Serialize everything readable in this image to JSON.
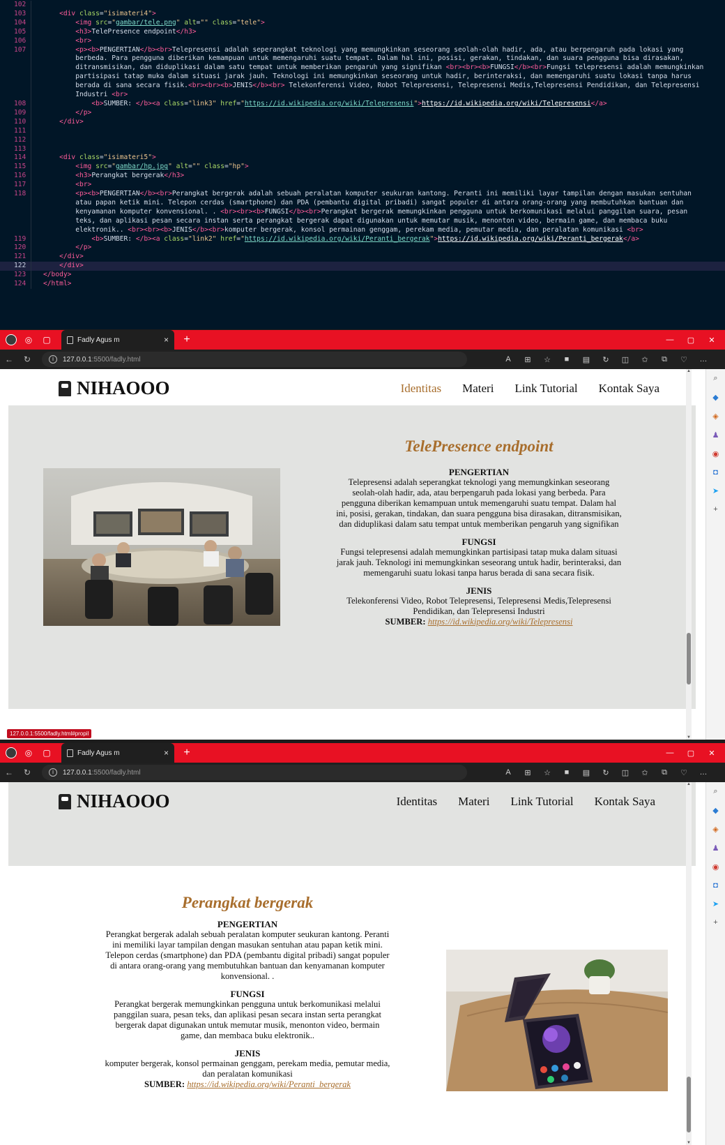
{
  "editor": {
    "lines": [
      {
        "n": "102",
        "html": ""
      },
      {
        "n": "103",
        "html": "    <span class=\"t\">&lt;div</span> <span class=\"a\">class</span>=<span class=\"s\">\"isimateri4\"</span><span class=\"t\">&gt;</span>"
      },
      {
        "n": "104",
        "html": "        <span class=\"t\">&lt;img</span> <span class=\"a\">src</span>=<span class=\"s\">\"</span><span class=\"u\">gambar/tele.png</span><span class=\"s\">\"</span> <span class=\"a\">alt</span>=<span class=\"s\">\"\"</span> <span class=\"a\">class</span>=<span class=\"s\">\"tele\"</span><span class=\"t\">&gt;</span>"
      },
      {
        "n": "105",
        "html": "        <span class=\"t\">&lt;h3&gt;</span>TelePresence endpoint<span class=\"t\">&lt;/h3&gt;</span>"
      },
      {
        "n": "106",
        "html": "        <span class=\"t\">&lt;br&gt;</span>"
      },
      {
        "n": "107",
        "html": "        <span class=\"t\">&lt;p&gt;&lt;b&gt;</span>PENGERTIAN<span class=\"t\">&lt;/b&gt;&lt;br&gt;</span>Telepresensi adalah seperangkat teknologi yang memungkinkan seseorang seolah-olah hadir, ada, atau berpengaruh pada lokasi yang"
      },
      {
        "n": "",
        "html": "        berbeda. Para pengguna diberikan kemampuan untuk memengaruhi suatu tempat. Dalam hal ini, posisi, gerakan, tindakan, dan suara pengguna bisa dirasakan,"
      },
      {
        "n": "",
        "html": "        ditransmisikan, dan diduplikasi dalam satu tempat untuk memberikan pengaruh yang signifikan <span class=\"t\">&lt;br&gt;&lt;br&gt;&lt;b&gt;</span>FUNGSI<span class=\"t\">&lt;/b&gt;&lt;br&gt;</span>Fungsi telepresensi adalah memungkinkan"
      },
      {
        "n": "",
        "html": "        partisipasi tatap muka dalam situasi jarak jauh. Teknologi ini memungkinkan seseorang untuk hadir, berinteraksi, dan memengaruhi suatu lokasi tanpa harus"
      },
      {
        "n": "",
        "html": "        berada di sana secara fisik.<span class=\"t\">&lt;br&gt;&lt;br&gt;&lt;b&gt;</span>JENIS<span class=\"t\">&lt;/b&gt;&lt;br&gt;</span> Telekonferensi Video, Robot Telepresensi, Telepresensi Medis,Telepresensi Pendidikan, dan Telepresensi"
      },
      {
        "n": "",
        "html": "        Industri <span class=\"t\">&lt;br&gt;</span>"
      },
      {
        "n": "108",
        "html": "            <span class=\"t\">&lt;b&gt;</span>SUMBER: <span class=\"t\">&lt;/b&gt;&lt;a</span> <span class=\"a\">class</span>=<span class=\"s\">\"link3\"</span> <span class=\"a\">href</span>=<span class=\"s\">\"</span><span class=\"u\">https://id.wikipedia.org/wiki/Telepresensi</span><span class=\"s\">\"</span><span class=\"t\">&gt;</span><span class=\"l\">https://id.wikipedia.org/wiki/Telepresensi</span><span class=\"t\">&lt;/a&gt;</span>"
      },
      {
        "n": "109",
        "html": "        <span class=\"t\">&lt;/p&gt;</span>"
      },
      {
        "n": "110",
        "html": "    <span class=\"t\">&lt;/div&gt;</span>"
      },
      {
        "n": "111",
        "html": ""
      },
      {
        "n": "112",
        "html": ""
      },
      {
        "n": "113",
        "html": ""
      },
      {
        "n": "114",
        "html": "    <span class=\"t\">&lt;div</span> <span class=\"a\">class</span>=<span class=\"s\">\"isimateri5\"</span><span class=\"t\">&gt;</span>"
      },
      {
        "n": "115",
        "html": "        <span class=\"t\">&lt;img</span> <span class=\"a\">src</span>=<span class=\"s\">\"</span><span class=\"u\">gambar/hp.jpg</span><span class=\"s\">\"</span> <span class=\"a\">alt</span>=<span class=\"s\">\"\"</span> <span class=\"a\">class</span>=<span class=\"s\">\"hp\"</span><span class=\"t\">&gt;</span>"
      },
      {
        "n": "116",
        "html": "        <span class=\"t\">&lt;h3&gt;</span>Perangkat bergerak<span class=\"t\">&lt;/h3&gt;</span>"
      },
      {
        "n": "117",
        "html": "        <span class=\"t\">&lt;br&gt;</span>"
      },
      {
        "n": "118",
        "html": "        <span class=\"t\">&lt;p&gt;&lt;b&gt;</span>PENGERTIAN<span class=\"t\">&lt;/b&gt;&lt;br&gt;</span>Perangkat bergerak adalah sebuah peralatan komputer seukuran kantong. Peranti ini memiliki layar tampilan dengan masukan sentuhan"
      },
      {
        "n": "",
        "html": "        atau papan ketik mini. Telepon cerdas (smartphone) dan PDA (pembantu digital pribadi) sangat populer di antara orang-orang yang membutuhkan bantuan dan"
      },
      {
        "n": "",
        "html": "        kenyamanan komputer konvensional. . <span class=\"t\">&lt;br&gt;&lt;br&gt;&lt;b&gt;</span>FUNGSI<span class=\"t\">&lt;/b&gt;&lt;br&gt;</span>Perangkat bergerak memungkinkan pengguna untuk berkomunikasi melalui panggilan suara, pesan"
      },
      {
        "n": "",
        "html": "        teks, dan aplikasi pesan secara instan serta perangkat bergerak dapat digunakan untuk memutar musik, menonton video, bermain game, dan membaca buku"
      },
      {
        "n": "",
        "html": "        elektronik.. <span class=\"t\">&lt;br&gt;&lt;br&gt;&lt;b&gt;</span>JENIS<span class=\"t\">&lt;/b&gt;&lt;br&gt;</span>komputer bergerak, konsol permainan genggam, perekam media, pemutar media, dan peralatan komunikasi <span class=\"t\">&lt;br&gt;</span>"
      },
      {
        "n": "119",
        "html": "            <span class=\"t\">&lt;b&gt;</span>SUMBER: <span class=\"t\">&lt;/b&gt;&lt;a</span> <span class=\"a\">class</span>=<span class=\"s\">\"link2\"</span> <span class=\"a\">href</span>=<span class=\"s\">\"</span><span class=\"u\">https://id.wikipedia.org/wiki/Peranti_bergerak</span><span class=\"s\">\"</span><span class=\"t\">&gt;</span><span class=\"l\">https://id.wikipedia.org/wiki/Peranti_bergerak</span><span class=\"t\">&lt;/a&gt;</span>"
      },
      {
        "n": "120",
        "html": "        <span class=\"t\">&lt;/p&gt;</span>"
      },
      {
        "n": "121",
        "html": "    <span class=\"t\">&lt;/div&gt;</span>"
      },
      {
        "n": "122",
        "html": "    <span class=\"t\">&lt;/div&gt;</span>",
        "highlight": true
      },
      {
        "n": "123",
        "html": "<span class=\"t\">&lt;/body&gt;</span>"
      },
      {
        "n": "124",
        "html": "<span class=\"t\">&lt;/html&gt;</span>"
      }
    ]
  },
  "browser": {
    "tab_title": "Fadly Agus m",
    "tab_close": "×",
    "new_tab": "+",
    "url_host": "127.0.0.1",
    "url_path": ":5500/fadly.html",
    "status_url": "127.0.0.1:5500/fadly.html#propil"
  },
  "site": {
    "logo": "NIHAOOO",
    "nav": [
      "Identitas",
      "Materi",
      "Link Tutorial",
      "Kontak Saya"
    ]
  },
  "materi4": {
    "title": "TelePresence endpoint",
    "pengertian_head": "PENGERTIAN",
    "pengertian": "Telepresensi adalah seperangkat teknologi yang memungkinkan seseorang seolah-olah hadir, ada, atau berpengaruh pada lokasi yang berbeda. Para pengguna diberikan kemampuan untuk memengaruhi suatu tempat. Dalam hal ini, posisi, gerakan, tindakan, dan suara pengguna bisa dirasakan, ditransmisikan, dan diduplikasi dalam satu tempat untuk memberikan pengaruh yang signifikan",
    "fungsi_head": "FUNGSI",
    "fungsi": "Fungsi telepresensi adalah memungkinkan partisipasi tatap muka dalam situasi jarak jauh. Teknologi ini memungkinkan seseorang untuk hadir, berinteraksi, dan memengaruhi suatu lokasi tanpa harus berada di sana secara fisik.",
    "jenis_head": "JENIS",
    "jenis": "Telekonferensi Video, Robot Telepresensi, Telepresensi Medis,Telepresensi Pendidikan, dan Telepresensi Industri",
    "sumber_label": "SUMBER:",
    "sumber_link": "https://id.wikipedia.org/wiki/Telepresensi"
  },
  "materi5": {
    "title": "Perangkat bergerak",
    "pengertian_head": "PENGERTIAN",
    "pengertian": "Perangkat bergerak adalah sebuah peralatan komputer seukuran kantong. Peranti ini memiliki layar tampilan dengan masukan sentuhan atau papan ketik mini. Telepon cerdas (smartphone) dan PDA (pembantu digital pribadi) sangat populer di antara orang-orang yang membutuhkan bantuan dan kenyamanan komputer konvensional. .",
    "fungsi_head": "FUNGSI",
    "fungsi": "Perangkat bergerak memungkinkan pengguna untuk berkomunikasi melalui panggilan suara, pesan teks, dan aplikasi pesan secara instan serta perangkat bergerak dapat digunakan untuk memutar musik, menonton video, bermain game, dan membaca buku elektronik..",
    "jenis_head": "JENIS",
    "jenis": "komputer bergerak, konsol permainan genggam, perekam media, pemutar media, dan peralatan komunikasi",
    "sumber_label": "SUMBER:",
    "sumber_link": "https://id.wikipedia.org/wiki/Peranti_bergerak"
  },
  "colors": {
    "accent": "#a86e2d",
    "tabbar": "#e81123",
    "band": "#e2e3e1"
  }
}
